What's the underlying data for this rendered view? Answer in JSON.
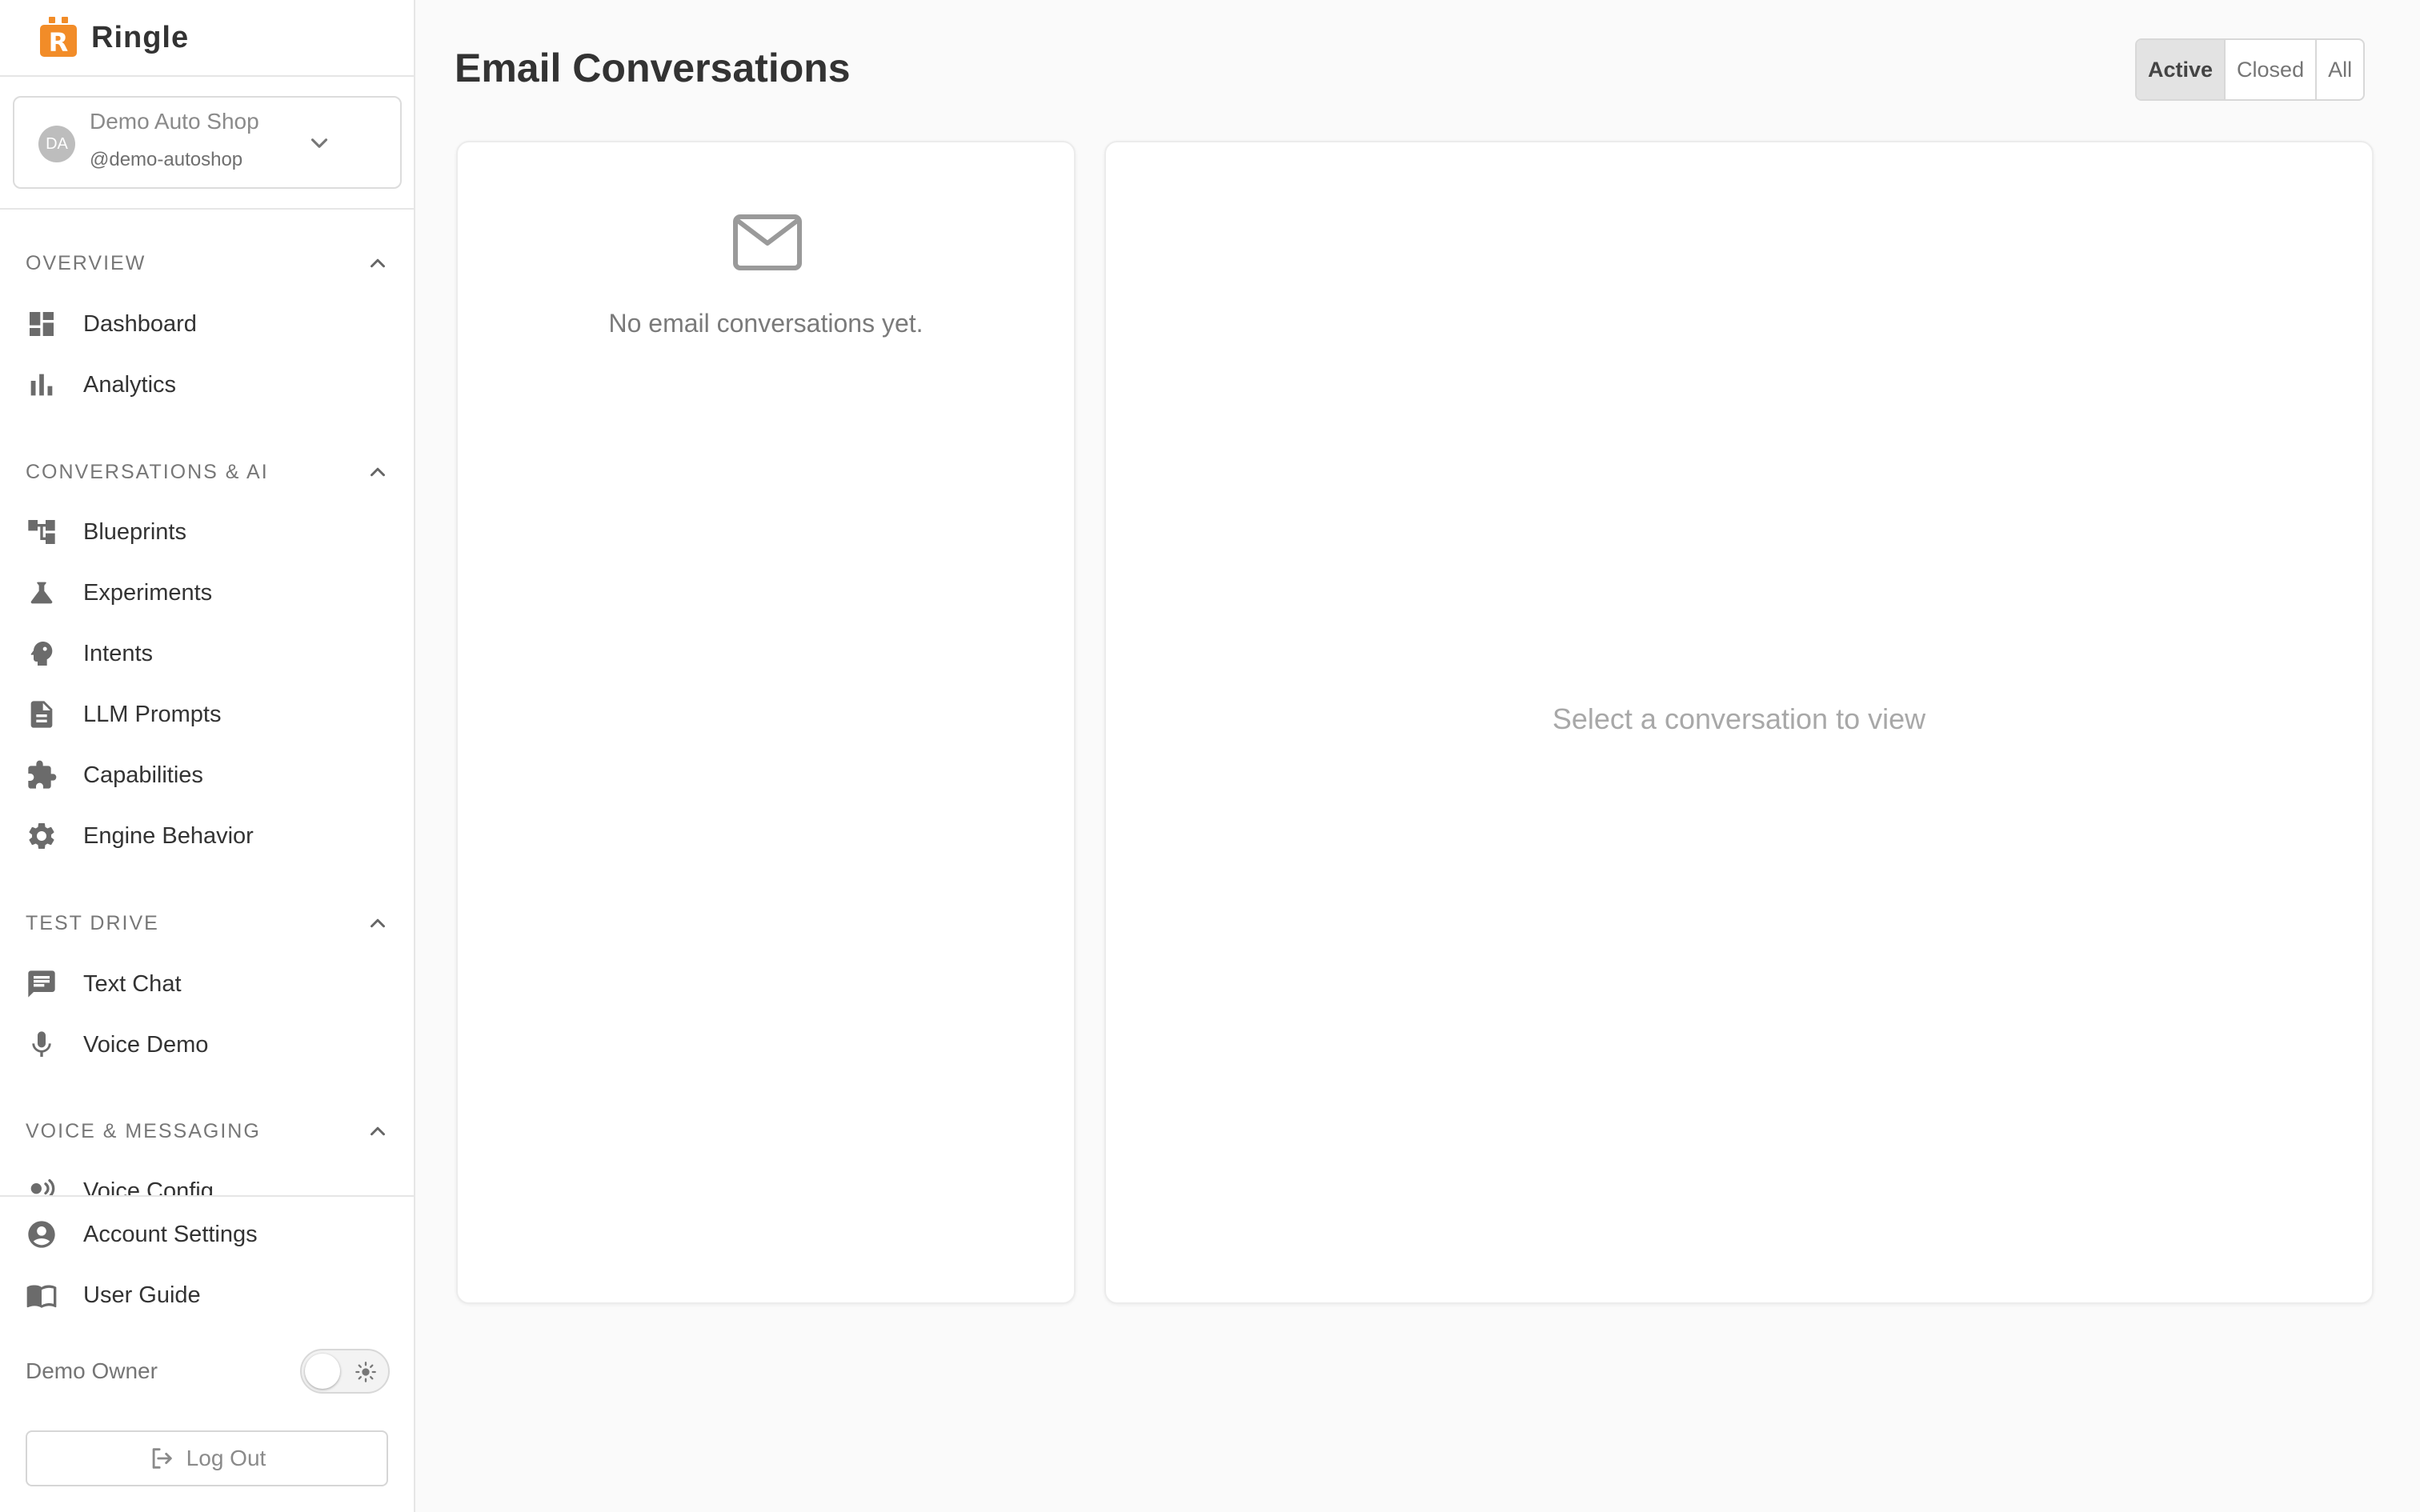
{
  "brand": {
    "name": "Ringle"
  },
  "org": {
    "avatar_initials": "DA",
    "name": "Demo Auto Shop",
    "handle": "@demo-autoshop"
  },
  "sidebar": {
    "sections": [
      {
        "title": "OVERVIEW",
        "items": [
          {
            "label": "Dashboard",
            "icon": "dashboard-icon"
          },
          {
            "label": "Analytics",
            "icon": "bar-chart-icon"
          }
        ]
      },
      {
        "title": "CONVERSATIONS & AI",
        "items": [
          {
            "label": "Blueprints",
            "icon": "tree-icon"
          },
          {
            "label": "Experiments",
            "icon": "flask-icon"
          },
          {
            "label": "Intents",
            "icon": "psychology-icon"
          },
          {
            "label": "LLM Prompts",
            "icon": "document-icon"
          },
          {
            "label": "Capabilities",
            "icon": "puzzle-icon"
          },
          {
            "label": "Engine Behavior",
            "icon": "gear-icon"
          }
        ]
      },
      {
        "title": "TEST DRIVE",
        "items": [
          {
            "label": "Text Chat",
            "icon": "chat-icon"
          },
          {
            "label": "Voice Demo",
            "icon": "microphone-icon"
          }
        ]
      },
      {
        "title": "VOICE & MESSAGING",
        "items": [
          {
            "label": "Voice Config",
            "icon": "voice-icon"
          }
        ]
      }
    ],
    "bottom_items": [
      {
        "label": "Account Settings",
        "icon": "account-circle-icon"
      },
      {
        "label": "User Guide",
        "icon": "book-icon"
      }
    ],
    "user_name": "Demo Owner",
    "logout_label": "Log Out"
  },
  "main": {
    "title": "Email Conversations",
    "filters": [
      {
        "label": "Active",
        "selected": true
      },
      {
        "label": "Closed",
        "selected": false
      },
      {
        "label": "All",
        "selected": false
      }
    ],
    "empty_list_text": "No email conversations yet.",
    "detail_placeholder": "Select a conversation to view"
  },
  "colors": {
    "brand_orange": "#f28c28",
    "text_primary": "#333333",
    "text_muted": "#777777",
    "active_filter_bg": "#e3e3e3"
  }
}
